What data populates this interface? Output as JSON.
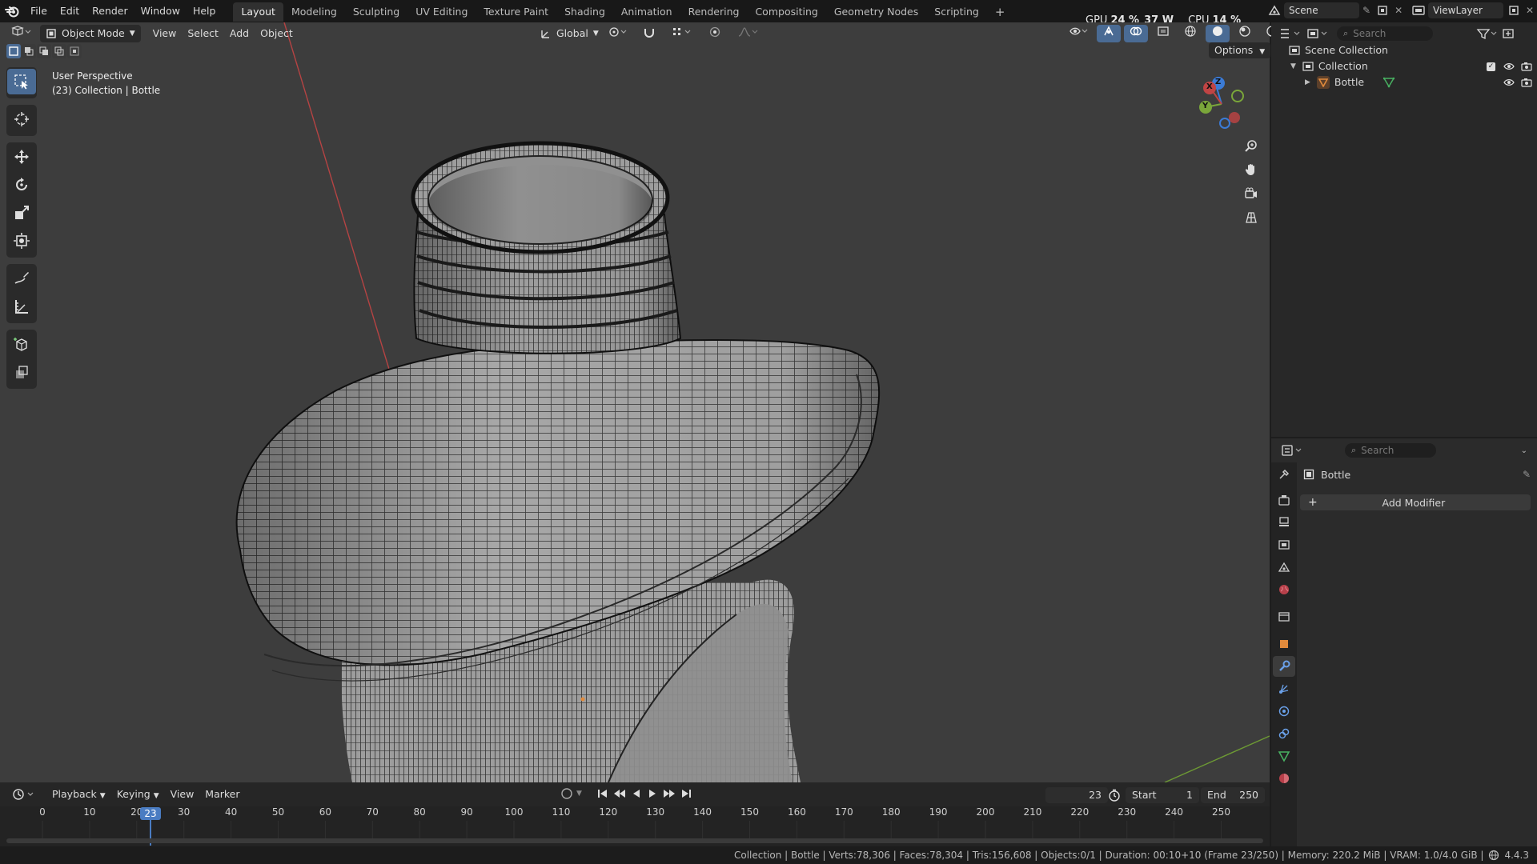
{
  "menubar": {
    "items": [
      "File",
      "Edit",
      "Render",
      "Window",
      "Help"
    ],
    "workspaces": [
      "Layout",
      "Modeling",
      "Sculpting",
      "UV Editing",
      "Texture Paint",
      "Shading",
      "Animation",
      "Rendering",
      "Compositing",
      "Geometry Nodes",
      "Scripting"
    ],
    "active_workspace": "Layout",
    "add_tab": "+",
    "gpu_label": "GPU",
    "gpu_value": "24 %",
    "gpu_power": "37 W",
    "cpu_label": "CPU",
    "cpu_value": "14 %",
    "scene_name": "Scene",
    "view_layer": "ViewLayer"
  },
  "viewport_header": {
    "mode": "Object Mode",
    "menus": [
      "View",
      "Select",
      "Add",
      "Object"
    ],
    "orientation": "Global",
    "options": "Options"
  },
  "viewport": {
    "perspective": "User Perspective",
    "collection_info": "(23) Collection | Bottle",
    "gizmo": {
      "x": "X",
      "y": "Y",
      "z": "Z"
    }
  },
  "timeline": {
    "menus": [
      "Playback",
      "Keying",
      "View",
      "Marker"
    ],
    "current_frame": "23",
    "start_label": "Start",
    "start_value": "1",
    "end_label": "End",
    "end_value": "250",
    "ticks": [
      "0",
      "10",
      "20",
      "30",
      "40",
      "50",
      "60",
      "70",
      "80",
      "90",
      "100",
      "110",
      "120",
      "130",
      "140",
      "150",
      "160",
      "170",
      "180",
      "190",
      "200",
      "210",
      "220",
      "230",
      "240",
      "250"
    ],
    "playhead": "23"
  },
  "statusbar": {
    "text": "Collection | Bottle | Verts:78,306 | Faces:78,304 | Tris:156,608 | Objects:0/1 | Duration: 00:10+10 (Frame 23/250) | Memory: 220.2 MiB | VRAM: 1.0/4.0 GiB |",
    "version": "4.4.3"
  },
  "outliner": {
    "search_placeholder": "Search",
    "scene_collection": "Scene Collection",
    "collection": "Collection",
    "object": "Bottle"
  },
  "properties": {
    "search_placeholder": "Search",
    "object_name": "Bottle",
    "add_modifier": "Add Modifier"
  },
  "colors": {
    "accent": "#4a6b94",
    "x_axis": "#c04444",
    "y_axis": "#7aa63a",
    "z_axis": "#3b7bd6",
    "object_orange": "#e08a3c",
    "mesh_green": "#48b061"
  }
}
